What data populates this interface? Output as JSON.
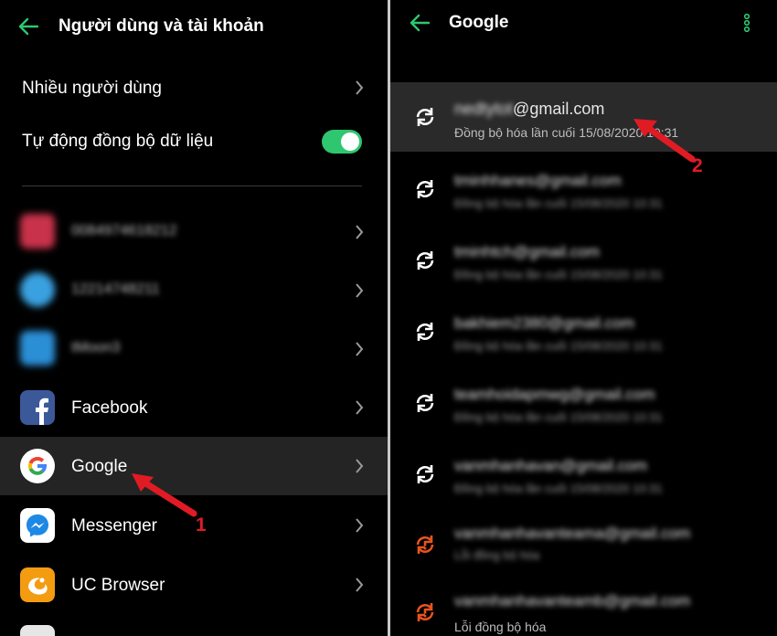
{
  "left": {
    "title": "Người dùng và tài khoản",
    "menu": {
      "multiple_users": "Nhiều người dùng",
      "auto_sync": "Tự động đồng bộ dữ liệu",
      "auto_sync_on": true
    },
    "accounts": [
      {
        "label": "0084974618212",
        "icon": "red-app-icon",
        "blurred": true
      },
      {
        "label": "12214748211",
        "icon": "blue-app-icon",
        "blurred": true
      },
      {
        "label": "tMoon3",
        "icon": "twitter-icon",
        "blurred": true
      },
      {
        "label": "Facebook",
        "icon": "facebook-icon"
      },
      {
        "label": "Google",
        "icon": "google-icon",
        "selected": true
      },
      {
        "label": "Messenger",
        "icon": "messenger-icon"
      },
      {
        "label": "UC Browser",
        "icon": "uc-browser-icon"
      }
    ]
  },
  "right": {
    "title": "Google",
    "accounts": [
      {
        "email_hidden": "nedtytot",
        "email": "@gmail.com",
        "sub": "Đồng bộ hóa lần cuối 15/08/2020 10:31",
        "selected": true,
        "status": "ok"
      },
      {
        "email": "tminhhanes@gmail.com",
        "sub": "Đồng bộ hóa lần cuối 15/08/2020 10:31",
        "blurred": true,
        "status": "ok"
      },
      {
        "email": "tminhtch@gmail.com",
        "sub": "Đồng bộ hóa lần cuối 15/08/2020 10:31",
        "blurred": true,
        "status": "ok"
      },
      {
        "email": "bakhiem2380@gmail.com",
        "sub": "Đồng bộ hóa lần cuối 15/08/2020 10:31",
        "blurred": true,
        "status": "ok"
      },
      {
        "email": "teamhoidapmwg@gmail.com",
        "sub": "Đồng bộ hóa lần cuối 15/08/2020 10:31",
        "blurred": true,
        "status": "ok"
      },
      {
        "email": "vanmhanhavan@gmail.com",
        "sub": "Đồng bộ hóa lần cuối 15/08/2020 10:31",
        "blurred": true,
        "status": "ok"
      },
      {
        "email": "vanmhanhavanteama@gmail.com",
        "sub": "Lỗi đồng bộ hóa",
        "blurred": true,
        "status": "error"
      },
      {
        "email": "vanmhanhavanteamb@gmail.com",
        "sub": "Lỗi đồng bộ hóa",
        "blurred_email": true,
        "status": "error"
      }
    ]
  },
  "annotations": {
    "arrow1_label": "1",
    "arrow2_label": "2"
  },
  "colors": {
    "accent": "#2ec770",
    "sync_error": "#e8541e",
    "arrow": "#e01b24",
    "selected_row": "#242424"
  }
}
